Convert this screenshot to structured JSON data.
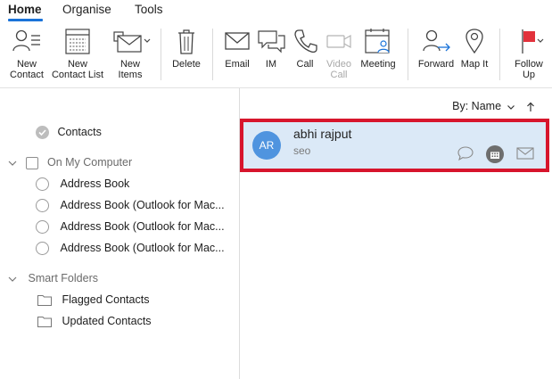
{
  "tabs": [
    {
      "label": "Home",
      "active": true
    },
    {
      "label": "Organise",
      "active": false
    },
    {
      "label": "Tools",
      "active": false
    }
  ],
  "ribbon": {
    "new_contact": "New\nContact",
    "new_contact_list": "New\nContact List",
    "new_items": "New\nItems",
    "delete": "Delete",
    "email": "Email",
    "im": "IM",
    "call": "Call",
    "video_call": "Video\nCall",
    "meeting": "Meeting",
    "forward": "Forward",
    "map_it": "Map It",
    "follow_up": "Follow\nUp"
  },
  "sidebar": {
    "contacts": "Contacts",
    "on_my_computer": "On My Computer",
    "address_books": [
      "Address Book",
      "Address Book (Outlook for Mac...",
      "Address Book (Outlook for Mac...",
      "Address Book (Outlook for Mac..."
    ],
    "smart_folders": "Smart Folders",
    "flagged_contacts": "Flagged Contacts",
    "updated_contacts": "Updated Contacts"
  },
  "list": {
    "sort_label": "By: Name",
    "contacts": [
      {
        "initials": "AR",
        "name": "abhi rajput",
        "subtitle": "seo"
      }
    ]
  },
  "colors": {
    "accent": "#1a73d9",
    "selection_bg": "#dbe9f7",
    "highlight_border": "#d7152c",
    "avatar_bg": "#4f94df",
    "follow_flag": "#e2323c"
  }
}
